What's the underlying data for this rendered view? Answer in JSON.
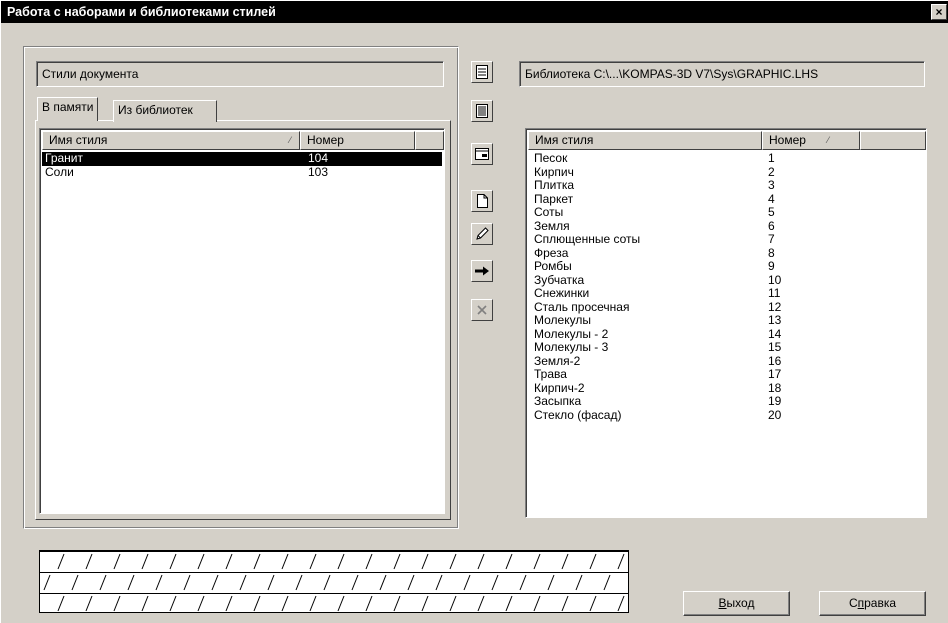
{
  "window": {
    "title": "Работа с наборами и библиотеками стилей",
    "close_glyph": "×"
  },
  "document_styles": {
    "label": "Стили документа"
  },
  "tabs": [
    {
      "label": "В памяти",
      "active": true
    },
    {
      "label": "Из библиотек",
      "active": false
    }
  ],
  "left_list": {
    "columns": {
      "name": "Имя стиля",
      "number": "Номер",
      "sort_glyph": "⁄"
    },
    "rows": [
      {
        "name": "Гранит",
        "number": "104",
        "selected": true
      },
      {
        "name": "Соли",
        "number": "103",
        "selected": false
      }
    ]
  },
  "library": {
    "path": "Библиотека C:\\...\\KOMPAS-3D V7\\Sys\\GRAPHIC.LHS"
  },
  "right_list": {
    "columns": {
      "name": "Имя стиля",
      "number": "Номер",
      "sort_glyph": "⁄"
    },
    "rows": [
      {
        "name": "Песок",
        "number": "1"
      },
      {
        "name": "Кирпич",
        "number": "2"
      },
      {
        "name": "Плитка",
        "number": "3"
      },
      {
        "name": "Паркет",
        "number": "4"
      },
      {
        "name": "Соты",
        "number": "5"
      },
      {
        "name": "Земля",
        "number": "6"
      },
      {
        "name": "Сплющенные соты",
        "number": "7"
      },
      {
        "name": "Фреза",
        "number": "8"
      },
      {
        "name": "Ромбы",
        "number": "9"
      },
      {
        "name": "Зубчатка",
        "number": "10"
      },
      {
        "name": "Снежинки",
        "number": "11"
      },
      {
        "name": "Сталь просечная",
        "number": "12"
      },
      {
        "name": "Молекулы",
        "number": "13"
      },
      {
        "name": "Молекулы - 2",
        "number": "14"
      },
      {
        "name": "Молекулы - 3",
        "number": "15"
      },
      {
        "name": "Земля-2",
        "number": "16"
      },
      {
        "name": "Трава",
        "number": "17"
      },
      {
        "name": "Кирпич-2",
        "number": "18"
      },
      {
        "name": "Засыпка",
        "number": "19"
      },
      {
        "name": "Стекло (фасад)",
        "number": "20"
      }
    ]
  },
  "toolbar": {
    "buttons": [
      {
        "icon": "document-set-icon"
      },
      {
        "icon": "document-list-icon"
      },
      {
        "icon": "window-form-icon"
      },
      {
        "icon": "new-document-icon"
      },
      {
        "icon": "pencil-icon"
      },
      {
        "icon": "arrow-right-icon"
      },
      {
        "icon": "delete-icon"
      }
    ]
  },
  "buttons": {
    "exit": {
      "label_accel": "В",
      "label_rest": "ыход"
    },
    "help": {
      "label_pre": "С",
      "label_accel": "п",
      "label_rest": "равка"
    }
  },
  "colors": {
    "face": "#d4d0c8",
    "titlebar": "#000000",
    "selection": "#000000"
  }
}
